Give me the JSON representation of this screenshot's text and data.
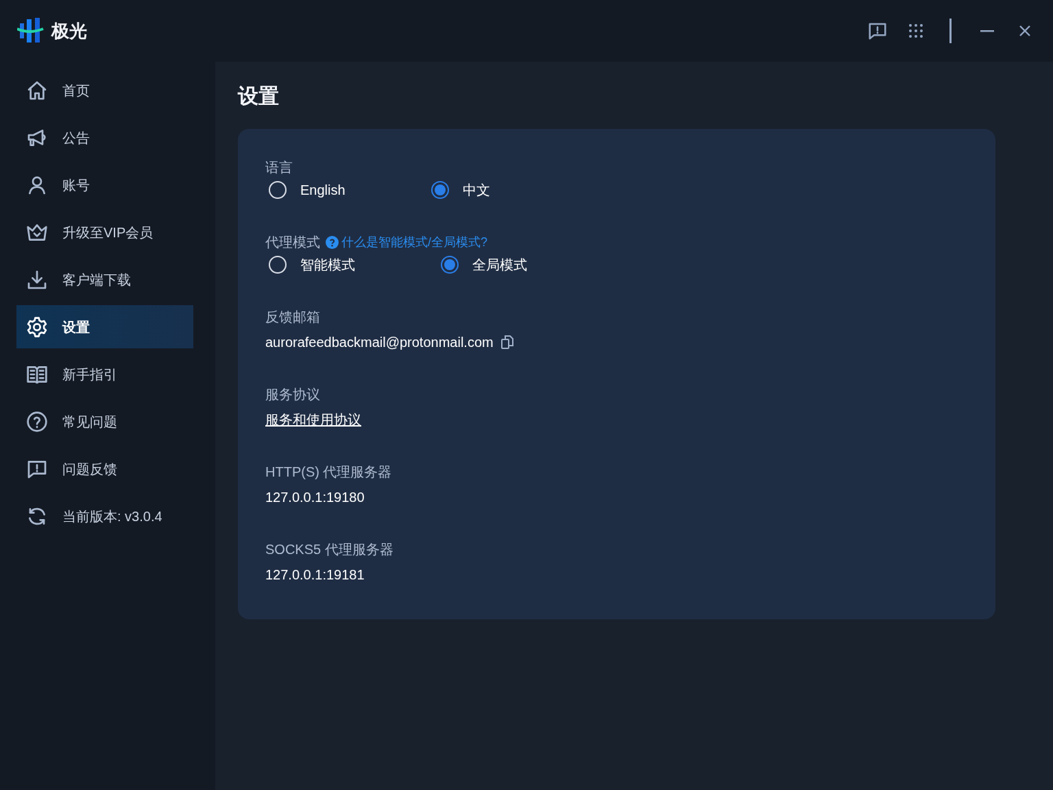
{
  "app": {
    "name": "极光"
  },
  "sidebar": {
    "items": [
      {
        "label": "首页",
        "selected": false
      },
      {
        "label": "公告",
        "selected": false
      },
      {
        "label": "账号",
        "selected": false
      },
      {
        "label": "升级至VIP会员",
        "selected": false
      },
      {
        "label": "客户端下载",
        "selected": false
      },
      {
        "label": "设置",
        "selected": true
      },
      {
        "label": "新手指引",
        "selected": false
      },
      {
        "label": "常见问题",
        "selected": false
      },
      {
        "label": "问题反馈",
        "selected": false
      },
      {
        "label": "当前版本: v3.0.4",
        "selected": false
      }
    ]
  },
  "page_title": "设置",
  "sections": [
    {
      "kind": "radio",
      "label": "语言",
      "options": [
        {
          "label": "English",
          "selected": false
        },
        {
          "label": "中文",
          "selected": true
        }
      ]
    },
    {
      "kind": "radio",
      "label": "代理模式",
      "help_link": "什么是智能模式/全局模式?",
      "options": [
        {
          "label": "智能模式",
          "selected": false
        },
        {
          "label": "全局模式",
          "selected": true
        }
      ]
    },
    {
      "kind": "copy",
      "label": "反馈邮箱",
      "value": "aurorafeedbackmail@protonmail.com"
    },
    {
      "kind": "link",
      "label": "服务协议",
      "value": "服务和使用协议"
    },
    {
      "kind": "text",
      "label": "HTTP(S) 代理服务器",
      "value": "127.0.0.1:19180"
    },
    {
      "kind": "text",
      "label": "SOCKS5 代理服务器",
      "value": "127.0.0.1:19181"
    }
  ]
}
